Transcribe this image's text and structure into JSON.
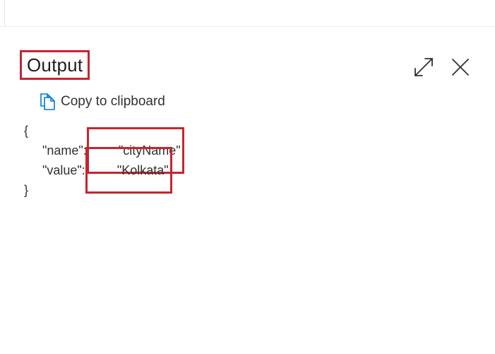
{
  "panel": {
    "title": "Output",
    "copy_label": "Copy to clipboard",
    "icons": {
      "expand": "expand-icon",
      "close": "close-icon",
      "copy": "copy-icon"
    },
    "accent_color": "#c4262e",
    "link_icon_color": "#0078d4"
  },
  "output": {
    "open_brace": "{",
    "close_brace": "}",
    "name_key": "\"name\":",
    "name_value": "\"cityName\"",
    "value_key": "\"value\":",
    "value_value": "\"Kolkata\""
  }
}
